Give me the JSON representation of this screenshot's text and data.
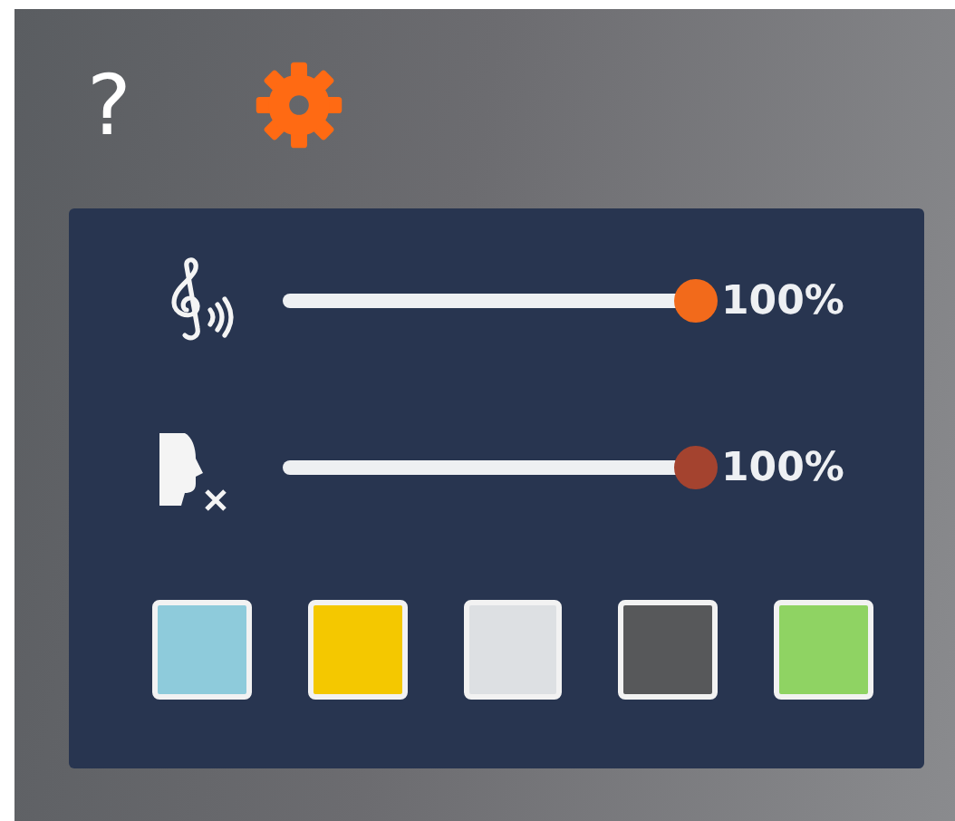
{
  "toolbar": {
    "help": "?",
    "settings_active": true
  },
  "sliders": [
    {
      "kind": "music",
      "level": 1,
      "color": "#f26a1b",
      "reading": "100%"
    },
    {
      "kind": "voice",
      "level": 1,
      "color": "#a4432f",
      "reading": "100%"
    }
  ],
  "swatches": [
    {
      "color": "#8ecbdb"
    },
    {
      "color": "#f4c800"
    },
    {
      "color": "#dde0e3"
    },
    {
      "color": "#57585a"
    },
    {
      "color": "#8fd363"
    }
  ]
}
